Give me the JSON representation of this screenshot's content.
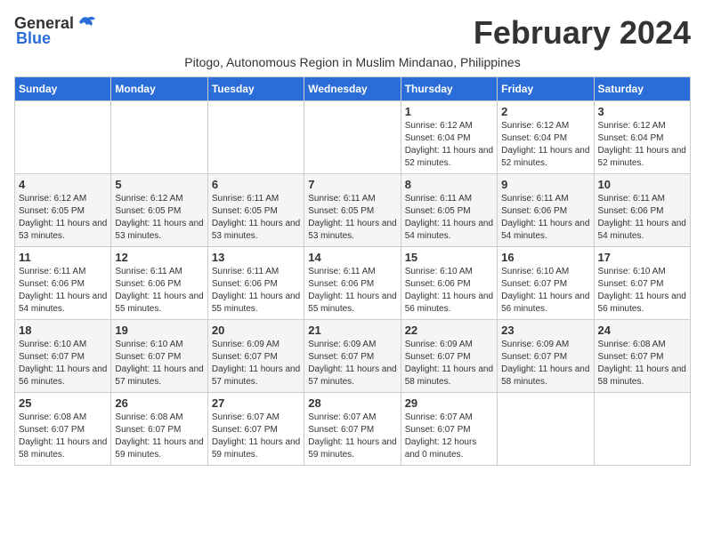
{
  "logo": {
    "general": "General",
    "blue": "Blue"
  },
  "title": "February 2024",
  "subtitle": "Pitogo, Autonomous Region in Muslim Mindanao, Philippines",
  "days_of_week": [
    "Sunday",
    "Monday",
    "Tuesday",
    "Wednesday",
    "Thursday",
    "Friday",
    "Saturday"
  ],
  "weeks": [
    [
      {
        "day": "",
        "sunrise": "",
        "sunset": "",
        "daylight": ""
      },
      {
        "day": "",
        "sunrise": "",
        "sunset": "",
        "daylight": ""
      },
      {
        "day": "",
        "sunrise": "",
        "sunset": "",
        "daylight": ""
      },
      {
        "day": "",
        "sunrise": "",
        "sunset": "",
        "daylight": ""
      },
      {
        "day": "1",
        "sunrise": "Sunrise: 6:12 AM",
        "sunset": "Sunset: 6:04 PM",
        "daylight": "Daylight: 11 hours and 52 minutes."
      },
      {
        "day": "2",
        "sunrise": "Sunrise: 6:12 AM",
        "sunset": "Sunset: 6:04 PM",
        "daylight": "Daylight: 11 hours and 52 minutes."
      },
      {
        "day": "3",
        "sunrise": "Sunrise: 6:12 AM",
        "sunset": "Sunset: 6:04 PM",
        "daylight": "Daylight: 11 hours and 52 minutes."
      }
    ],
    [
      {
        "day": "4",
        "sunrise": "Sunrise: 6:12 AM",
        "sunset": "Sunset: 6:05 PM",
        "daylight": "Daylight: 11 hours and 53 minutes."
      },
      {
        "day": "5",
        "sunrise": "Sunrise: 6:12 AM",
        "sunset": "Sunset: 6:05 PM",
        "daylight": "Daylight: 11 hours and 53 minutes."
      },
      {
        "day": "6",
        "sunrise": "Sunrise: 6:11 AM",
        "sunset": "Sunset: 6:05 PM",
        "daylight": "Daylight: 11 hours and 53 minutes."
      },
      {
        "day": "7",
        "sunrise": "Sunrise: 6:11 AM",
        "sunset": "Sunset: 6:05 PM",
        "daylight": "Daylight: 11 hours and 53 minutes."
      },
      {
        "day": "8",
        "sunrise": "Sunrise: 6:11 AM",
        "sunset": "Sunset: 6:05 PM",
        "daylight": "Daylight: 11 hours and 54 minutes."
      },
      {
        "day": "9",
        "sunrise": "Sunrise: 6:11 AM",
        "sunset": "Sunset: 6:06 PM",
        "daylight": "Daylight: 11 hours and 54 minutes."
      },
      {
        "day": "10",
        "sunrise": "Sunrise: 6:11 AM",
        "sunset": "Sunset: 6:06 PM",
        "daylight": "Daylight: 11 hours and 54 minutes."
      }
    ],
    [
      {
        "day": "11",
        "sunrise": "Sunrise: 6:11 AM",
        "sunset": "Sunset: 6:06 PM",
        "daylight": "Daylight: 11 hours and 54 minutes."
      },
      {
        "day": "12",
        "sunrise": "Sunrise: 6:11 AM",
        "sunset": "Sunset: 6:06 PM",
        "daylight": "Daylight: 11 hours and 55 minutes."
      },
      {
        "day": "13",
        "sunrise": "Sunrise: 6:11 AM",
        "sunset": "Sunset: 6:06 PM",
        "daylight": "Daylight: 11 hours and 55 minutes."
      },
      {
        "day": "14",
        "sunrise": "Sunrise: 6:11 AM",
        "sunset": "Sunset: 6:06 PM",
        "daylight": "Daylight: 11 hours and 55 minutes."
      },
      {
        "day": "15",
        "sunrise": "Sunrise: 6:10 AM",
        "sunset": "Sunset: 6:06 PM",
        "daylight": "Daylight: 11 hours and 56 minutes."
      },
      {
        "day": "16",
        "sunrise": "Sunrise: 6:10 AM",
        "sunset": "Sunset: 6:07 PM",
        "daylight": "Daylight: 11 hours and 56 minutes."
      },
      {
        "day": "17",
        "sunrise": "Sunrise: 6:10 AM",
        "sunset": "Sunset: 6:07 PM",
        "daylight": "Daylight: 11 hours and 56 minutes."
      }
    ],
    [
      {
        "day": "18",
        "sunrise": "Sunrise: 6:10 AM",
        "sunset": "Sunset: 6:07 PM",
        "daylight": "Daylight: 11 hours and 56 minutes."
      },
      {
        "day": "19",
        "sunrise": "Sunrise: 6:10 AM",
        "sunset": "Sunset: 6:07 PM",
        "daylight": "Daylight: 11 hours and 57 minutes."
      },
      {
        "day": "20",
        "sunrise": "Sunrise: 6:09 AM",
        "sunset": "Sunset: 6:07 PM",
        "daylight": "Daylight: 11 hours and 57 minutes."
      },
      {
        "day": "21",
        "sunrise": "Sunrise: 6:09 AM",
        "sunset": "Sunset: 6:07 PM",
        "daylight": "Daylight: 11 hours and 57 minutes."
      },
      {
        "day": "22",
        "sunrise": "Sunrise: 6:09 AM",
        "sunset": "Sunset: 6:07 PM",
        "daylight": "Daylight: 11 hours and 58 minutes."
      },
      {
        "day": "23",
        "sunrise": "Sunrise: 6:09 AM",
        "sunset": "Sunset: 6:07 PM",
        "daylight": "Daylight: 11 hours and 58 minutes."
      },
      {
        "day": "24",
        "sunrise": "Sunrise: 6:08 AM",
        "sunset": "Sunset: 6:07 PM",
        "daylight": "Daylight: 11 hours and 58 minutes."
      }
    ],
    [
      {
        "day": "25",
        "sunrise": "Sunrise: 6:08 AM",
        "sunset": "Sunset: 6:07 PM",
        "daylight": "Daylight: 11 hours and 58 minutes."
      },
      {
        "day": "26",
        "sunrise": "Sunrise: 6:08 AM",
        "sunset": "Sunset: 6:07 PM",
        "daylight": "Daylight: 11 hours and 59 minutes."
      },
      {
        "day": "27",
        "sunrise": "Sunrise: 6:07 AM",
        "sunset": "Sunset: 6:07 PM",
        "daylight": "Daylight: 11 hours and 59 minutes."
      },
      {
        "day": "28",
        "sunrise": "Sunrise: 6:07 AM",
        "sunset": "Sunset: 6:07 PM",
        "daylight": "Daylight: 11 hours and 59 minutes."
      },
      {
        "day": "29",
        "sunrise": "Sunrise: 6:07 AM",
        "sunset": "Sunset: 6:07 PM",
        "daylight": "Daylight: 12 hours and 0 minutes."
      },
      {
        "day": "",
        "sunrise": "",
        "sunset": "",
        "daylight": ""
      },
      {
        "day": "",
        "sunrise": "",
        "sunset": "",
        "daylight": ""
      }
    ]
  ]
}
